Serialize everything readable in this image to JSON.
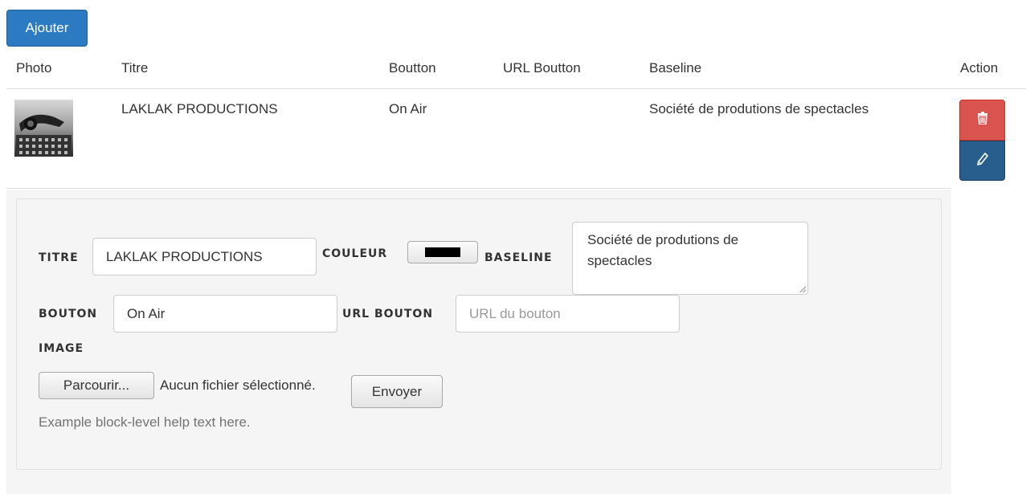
{
  "toolbar": {
    "add_label": "Ajouter"
  },
  "table": {
    "headers": {
      "photo": "Photo",
      "titre": "Titre",
      "bouton": "Boutton",
      "url_bouton": "URL Boutton",
      "baseline": "Baseline",
      "action": "Action"
    },
    "rows": [
      {
        "titre": "LAKLAK PRODUCTIONS",
        "bouton": "On Air",
        "url_bouton": "",
        "baseline": "Société de produtions de spectacles"
      }
    ]
  },
  "form": {
    "titre_label": "TITRE",
    "titre_value": "LAKLAK PRODUCTIONS",
    "couleur_label": "COULEUR",
    "couleur_value": "#000000",
    "baseline_label": "BASELINE",
    "baseline_value": "Société de produtions de spectacles",
    "bouton_label": "BOUTON",
    "bouton_value": "On Air",
    "url_bouton_label": "URL BOUTON",
    "url_bouton_placeholder": "URL du bouton",
    "image_label": "IMAGE",
    "browse_label": "Parcourir...",
    "file_status": "Aucun fichier sélectionné.",
    "send_label": "Envoyer",
    "help_text": "Example block-level help text here."
  },
  "icons": {
    "delete": "trash-icon",
    "edit": "pencil-icon"
  },
  "colors": {
    "primary": "#2c7bc2",
    "danger": "#d9534f",
    "edit": "#285e8e"
  }
}
